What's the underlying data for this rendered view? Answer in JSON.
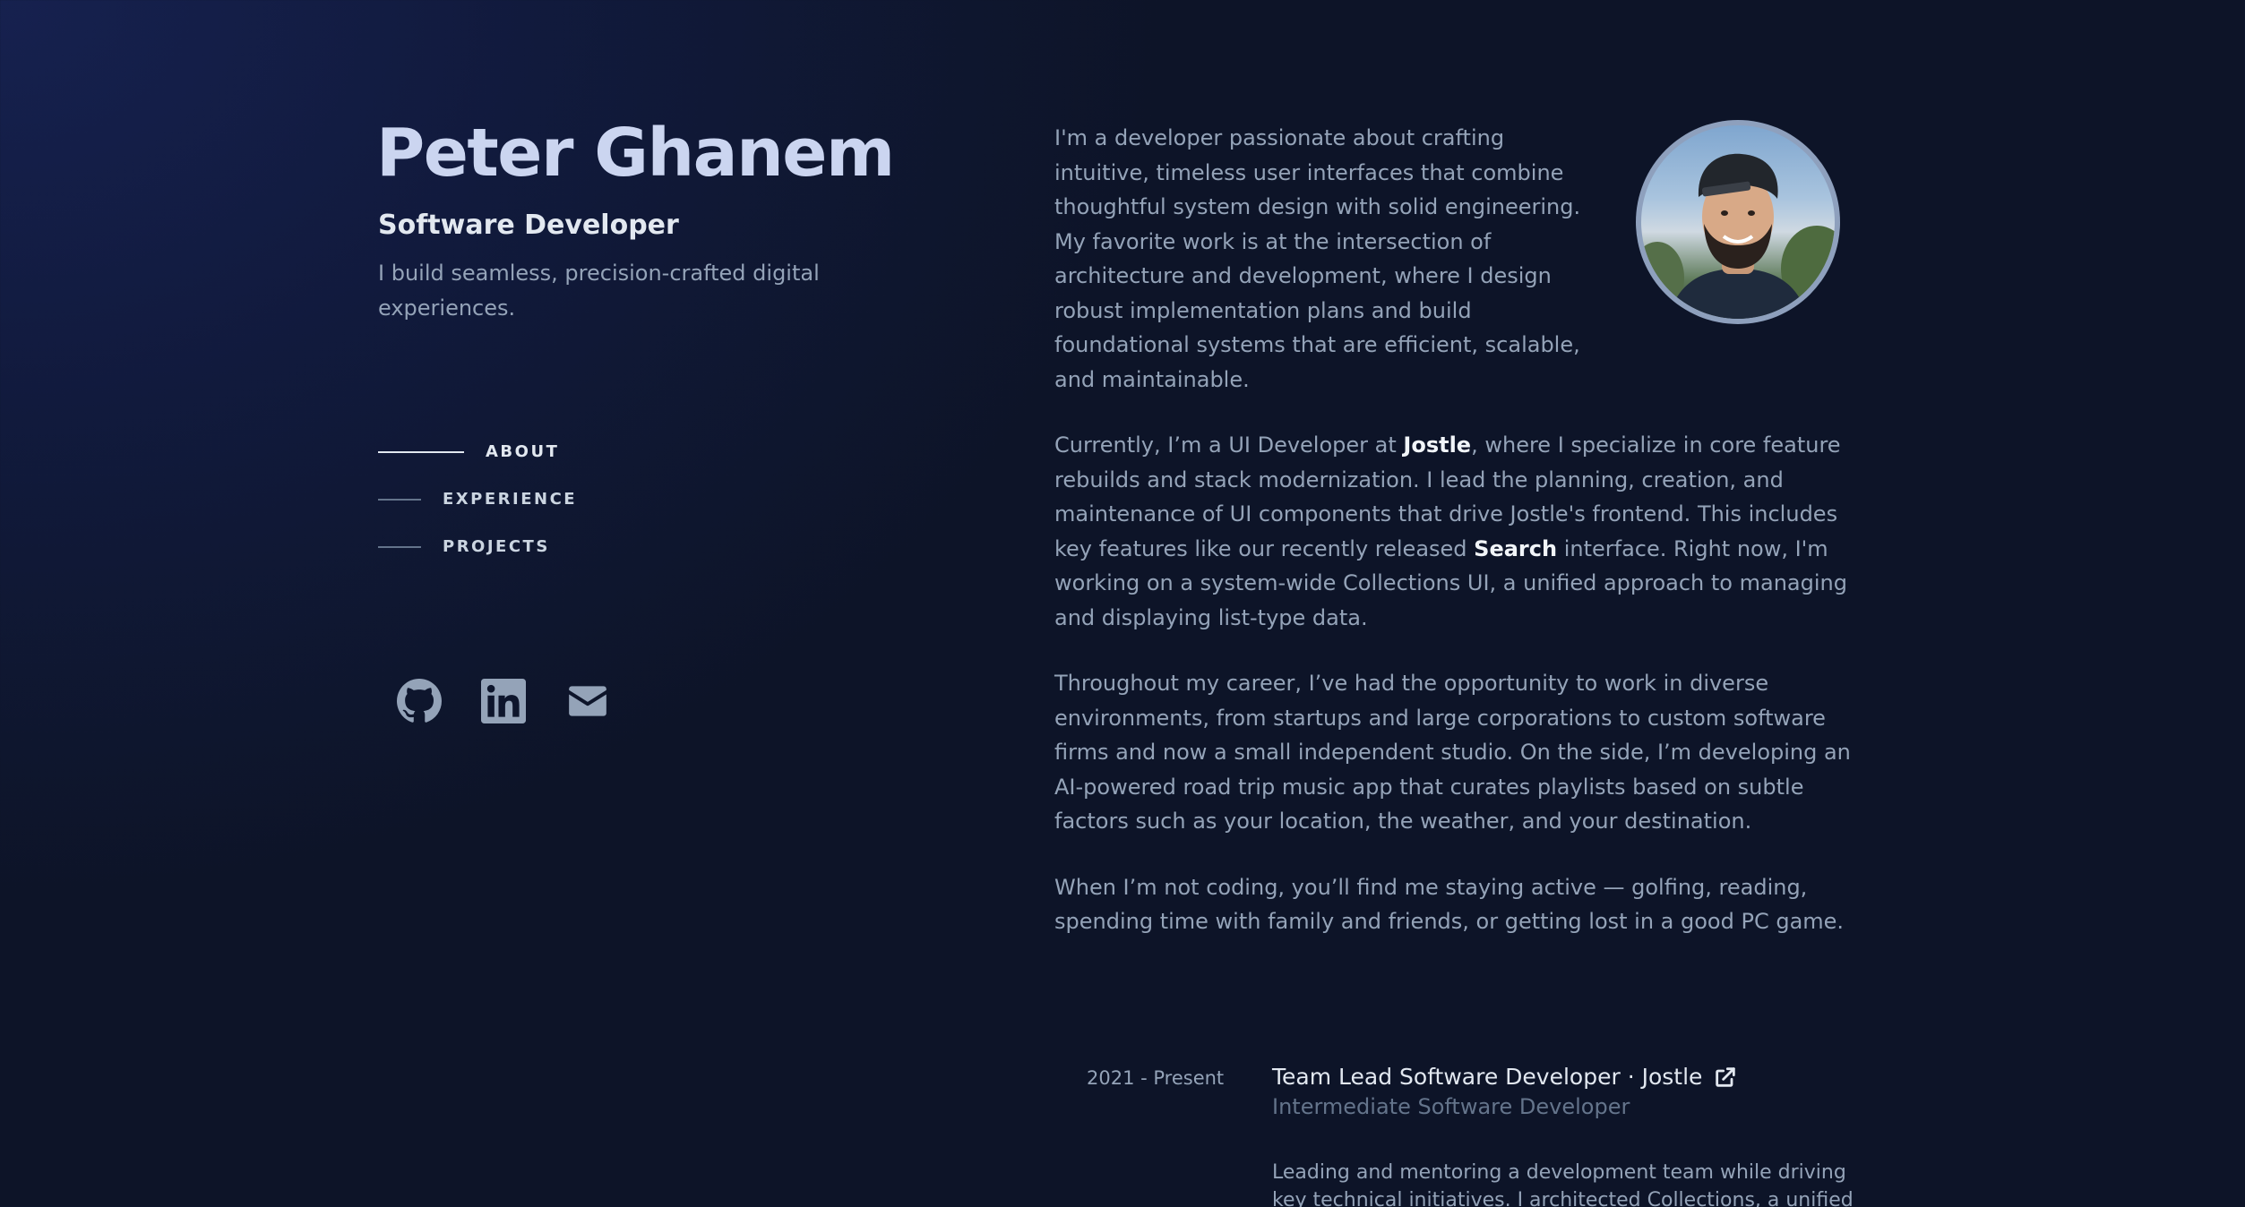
{
  "header": {
    "name": "Peter Ghanem",
    "role": "Software Developer",
    "tagline": "I build seamless, precision-crafted digital experiences."
  },
  "nav": {
    "items": [
      {
        "label": "ABOUT",
        "active": true
      },
      {
        "label": "EXPERIENCE",
        "active": false
      },
      {
        "label": "PROJECTS",
        "active": false
      }
    ]
  },
  "socials": {
    "icons": [
      "github-icon",
      "linkedin-icon",
      "email-icon"
    ]
  },
  "about": {
    "p1": "I'm a developer passionate about crafting intuitive, timeless user interfaces that combine thoughtful system design with solid engineering. My favorite work is at the intersection of architecture and development, where I design robust implementation plans and build foundational systems that are efficient, scalable, and maintainable.",
    "p2_a": "Currently, I’m a UI Developer at ",
    "p2_company": "Jostle",
    "p2_b": ", where I specialize in core feature rebuilds and stack modernization. I lead the planning, creation, and maintenance of UI components that drive Jostle's frontend. This includes key features like our recently released ",
    "p2_feature": "Search",
    "p2_c": " interface. Right now, I'm working on a system-wide Collections UI, a unified approach to managing and displaying list-type data.",
    "p3": "Throughout my career, I’ve had the opportunity to work in diverse environments, from startups and large corporations to custom software firms and now a small independent studio. On the side, I’m developing an AI-powered road trip music app that curates playlists based on subtle factors such as your location, the weather, and your destination.",
    "p4": "When I’m not coding, you’ll find me staying active — golfing, reading, spending time with family and friends, or getting lost in a good PC game."
  },
  "experience": {
    "items": [
      {
        "date": "2021 - Present",
        "title": "Team Lead Software Developer · Jostle",
        "subtitle": "Intermediate Software Developer",
        "description": "Leading and mentoring a development team while driving key technical initiatives. I architected Collections, a unified"
      }
    ]
  },
  "colors": {
    "background": "#0f1731",
    "heading": "#cbd5f0",
    "text": "#94a3b8",
    "highlight": "#f1f5f9"
  }
}
